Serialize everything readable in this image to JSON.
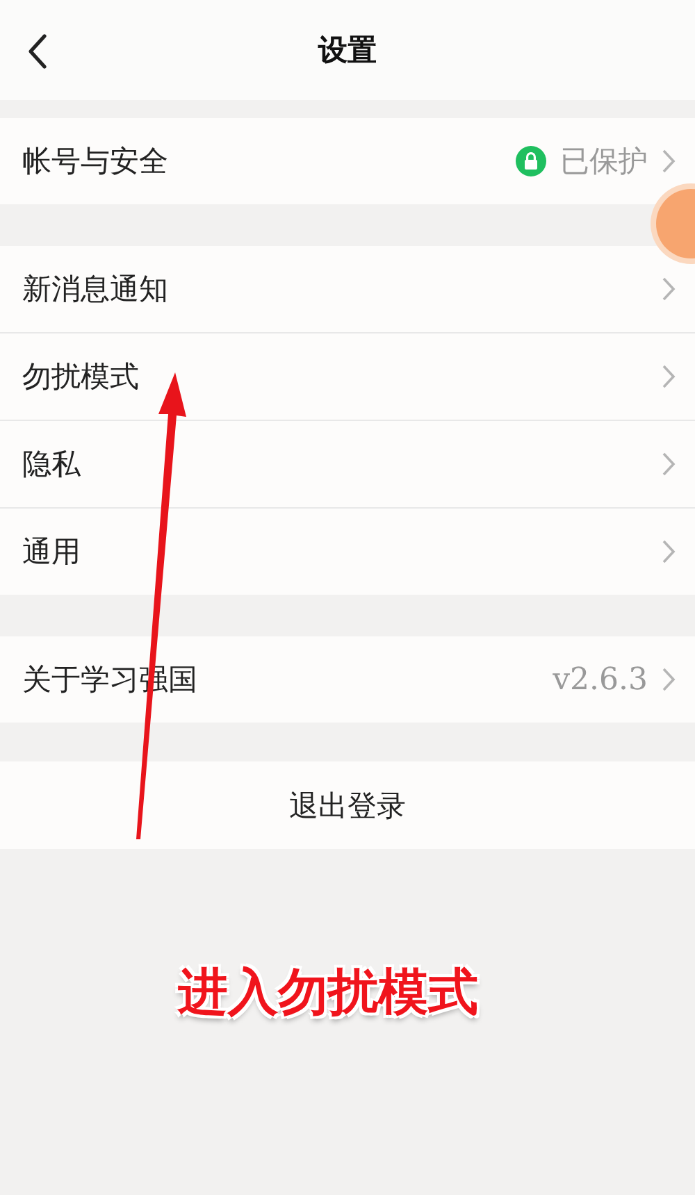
{
  "header": {
    "title": "设置"
  },
  "sections": [
    {
      "rows": [
        {
          "label": "帐号与安全",
          "kind": "lock",
          "value": "已保护"
        }
      ]
    },
    {
      "rows": [
        {
          "label": "新消息通知",
          "kind": "plain"
        },
        {
          "label": "勿扰模式",
          "kind": "plain"
        },
        {
          "label": "隐私",
          "kind": "plain"
        },
        {
          "label": "通用",
          "kind": "plain"
        }
      ]
    },
    {
      "rows": [
        {
          "label": "关于学习强国",
          "kind": "text",
          "value": "v2.6.3"
        }
      ]
    }
  ],
  "logout": {
    "label": "退出登录"
  },
  "annotation": {
    "caption": "进入勿扰模式"
  }
}
